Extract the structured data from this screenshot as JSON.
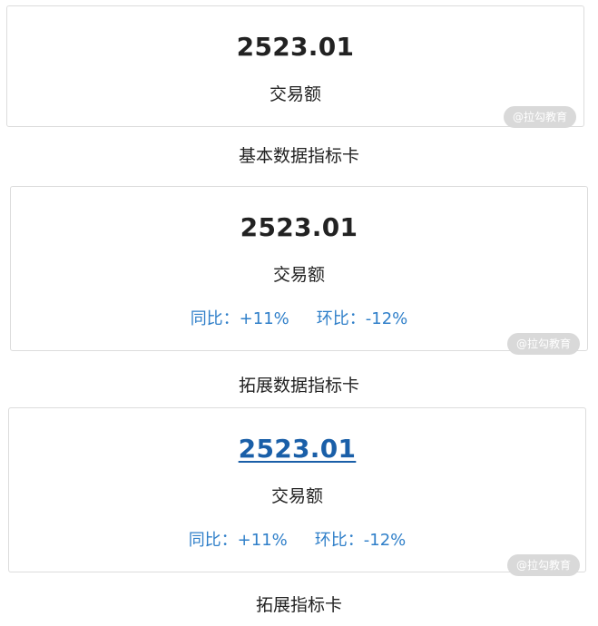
{
  "cards": [
    {
      "value": "2523.01",
      "label": "交易额",
      "caption": "基本数据指标卡"
    },
    {
      "value": "2523.01",
      "label": "交易额",
      "yoy": "同比：+11%",
      "mom": "环比：-12%",
      "caption": "拓展数据指标卡"
    },
    {
      "value": "2523.01",
      "label": "交易额",
      "yoy": "同比：+11%",
      "mom": "环比：-12%",
      "caption": "拓展指标卡"
    }
  ],
  "watermark": "@拉勾教育",
  "colors": {
    "compare_text": "#2f7fc9",
    "link_value": "#1a5fa8",
    "border": "#dcdcdc"
  }
}
